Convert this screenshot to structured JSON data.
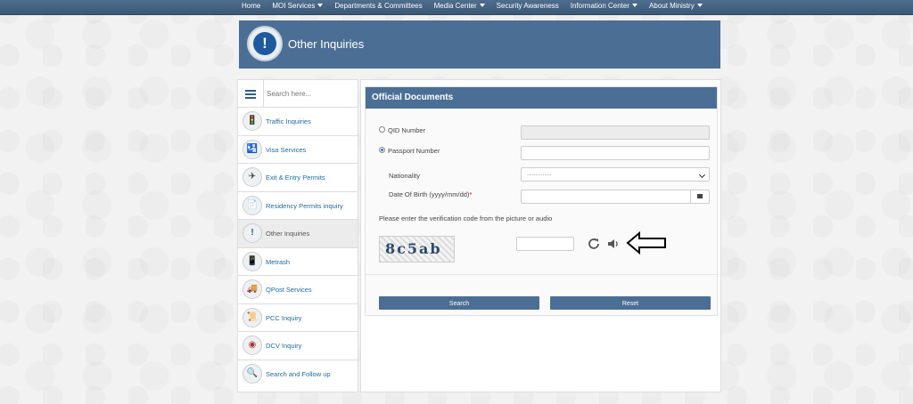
{
  "nav": {
    "items": [
      {
        "label": "Home",
        "dropdown": false
      },
      {
        "label": "MOI Services",
        "dropdown": true
      },
      {
        "label": "Departments & Committees",
        "dropdown": false
      },
      {
        "label": "Media Center",
        "dropdown": true
      },
      {
        "label": "Security Awareness",
        "dropdown": false
      },
      {
        "label": "Information Center",
        "dropdown": true
      },
      {
        "label": "About Ministry",
        "dropdown": true
      }
    ]
  },
  "banner": {
    "title": "Other Inquiries",
    "icon": "info-exclamation-icon"
  },
  "sidebar": {
    "search_placeholder": "Search here...",
    "items": [
      {
        "label": "Traffic Inquiries",
        "icon": "traffic-light-icon"
      },
      {
        "label": "Visa Services",
        "icon": "visa-icon"
      },
      {
        "label": "Exit & Entry Permits",
        "icon": "airplane-icon"
      },
      {
        "label": "Residency Permits inquiry",
        "icon": "residency-icon"
      },
      {
        "label": "Other Inquiries",
        "icon": "exclamation-icon",
        "active": true
      },
      {
        "label": "Metrash",
        "icon": "phone-icon"
      },
      {
        "label": "QPost Services",
        "icon": "truck-icon"
      },
      {
        "label": "PCC Inquiry",
        "icon": "certificate-icon"
      },
      {
        "label": "DCV Inquiry",
        "icon": "fingerprint-icon"
      },
      {
        "label": "Search and Follow up",
        "icon": "search-person-icon"
      }
    ]
  },
  "form": {
    "title": "Official Documents",
    "qid_label": "QID Number",
    "passport_label": "Passport Number",
    "nationality_label": "Nationality",
    "nationality_value": "..............",
    "dob_label": "Date Of Birth (yyyy/mm/dd)",
    "required_mark": "*",
    "verify_text": "Please enter the verification code from the picture or audio",
    "captcha_text": "8c5ab",
    "selected_option": "passport",
    "search_label": "Search",
    "reset_label": "Reset"
  },
  "colors": {
    "nav": "#3f5d7e",
    "header": "#4b6f94",
    "link": "#1f6aa0"
  }
}
